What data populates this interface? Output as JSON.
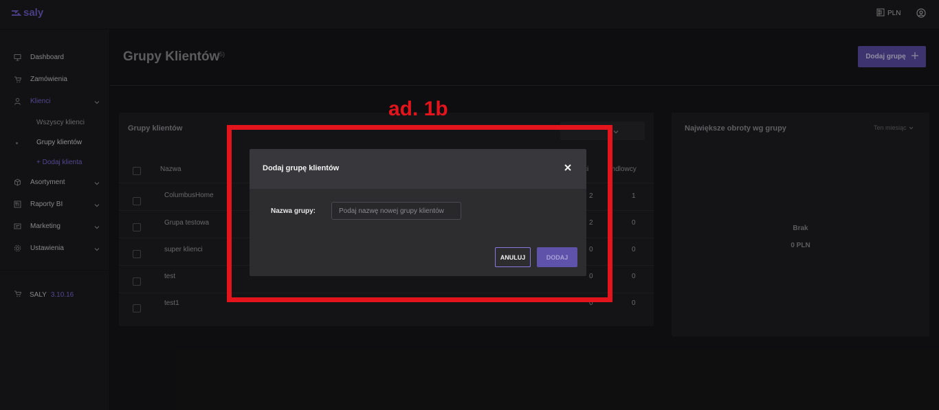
{
  "app": {
    "logo_text": "saly",
    "currency": "PLN",
    "brand_color": "#6e5dc6"
  },
  "sidebar": {
    "items": [
      {
        "label": "Dashboard",
        "icon": "monitor-icon"
      },
      {
        "label": "Zamówienia",
        "icon": "cart-icon"
      },
      {
        "label": "Klienci",
        "icon": "user-icon",
        "active": true
      },
      {
        "label": "Asortyment",
        "icon": "box-icon"
      },
      {
        "label": "Raporty BI",
        "icon": "report-icon"
      },
      {
        "label": "Marketing",
        "icon": "marketing-icon"
      },
      {
        "label": "Ustawienia",
        "icon": "gear-icon"
      }
    ],
    "sub_items": [
      {
        "label": "Wszyscy klienci"
      },
      {
        "label": "Grupy klientów",
        "current": true
      },
      {
        "label": "+ Dodaj klienta"
      }
    ],
    "version_name": "SALY",
    "version_number": "3.10.16"
  },
  "header": {
    "title": "Grupy Klientów",
    "count": "(5)",
    "add_button": "Dodaj grupę"
  },
  "groups_panel": {
    "title": "Grupy klientów",
    "columns": [
      "Nazwa",
      "ci",
      "andlowcy"
    ],
    "rows": [
      {
        "name": "ColumbusHome",
        "clients": "2",
        "sales": "1"
      },
      {
        "name": "Grupa testowa",
        "clients": "2",
        "sales": "0"
      },
      {
        "name": "super klienci",
        "clients": "0",
        "sales": "0"
      },
      {
        "name": "test",
        "clients": "0",
        "sales": "0"
      },
      {
        "name": "test1",
        "clients": "0",
        "sales": "0"
      }
    ]
  },
  "turnover_panel": {
    "title": "Największe obroty wg grupy",
    "filter": "Ten miesiąc",
    "empty_label": "Brak",
    "empty_value": "0 PLN"
  },
  "modal": {
    "title": "Dodaj grupę klientów",
    "field_label": "Nazwa grupy:",
    "field_value": "",
    "field_placeholder": "Podaj nazwę nowej grupy klientów",
    "cancel_label": "ANULUJ",
    "add_label": "DODAJ"
  },
  "annotation": {
    "text": "ad. 1b",
    "color": "#e3141c"
  }
}
